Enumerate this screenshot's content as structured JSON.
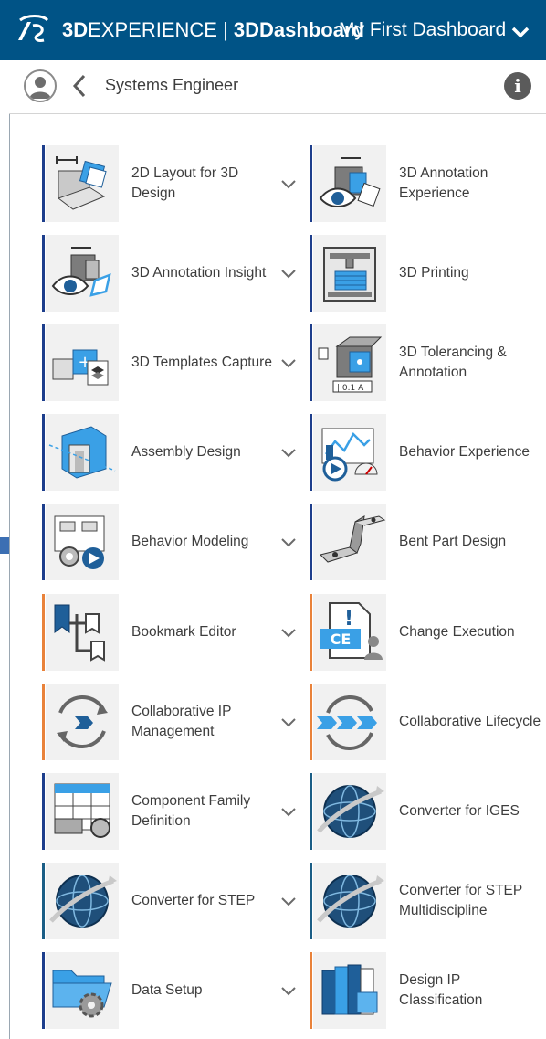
{
  "header": {
    "brand_bold": "3D",
    "brand_thin": "EXPERIENCE",
    "separator": " | ",
    "app": "3DDashboard",
    "dashboard_title": "My First Dashboard"
  },
  "subheader": {
    "role": "Systems Engineer"
  },
  "colors": {
    "topbar": "#005386",
    "navy_accent": "#1d3e8c",
    "orange_accent": "#e9823a",
    "teal_accent": "#1b5e86"
  },
  "apps": [
    {
      "label": "2D Layout for 3D\nDesign",
      "icon": "layout-2d-icon",
      "accent": "navy"
    },
    {
      "label": "3D Annotation\nExperience",
      "icon": "annotation-experience-icon",
      "accent": "navy"
    },
    {
      "label": "3D Annotation Insight",
      "icon": "annotation-insight-icon",
      "accent": "navy"
    },
    {
      "label": "3D Printing",
      "icon": "printer-3d-icon",
      "accent": "navy"
    },
    {
      "label": "3D Templates Capture",
      "icon": "templates-capture-icon",
      "accent": "navy"
    },
    {
      "label": "3D Tolerancing &\nAnnotation",
      "icon": "tolerancing-icon",
      "accent": "navy"
    },
    {
      "label": "Assembly Design",
      "icon": "assembly-icon",
      "accent": "navy"
    },
    {
      "label": "Behavior Experience",
      "icon": "behavior-experience-icon",
      "accent": "navy"
    },
    {
      "label": "Behavior Modeling",
      "icon": "behavior-modeling-icon",
      "accent": "navy"
    },
    {
      "label": "Bent Part Design",
      "icon": "bent-part-icon",
      "accent": "navy"
    },
    {
      "label": "Bookmark Editor",
      "icon": "bookmark-icon",
      "accent": "orange"
    },
    {
      "label": "Change Execution",
      "icon": "change-execution-icon",
      "accent": "orange"
    },
    {
      "label": "Collaborative IP\nManagement",
      "icon": "collab-ip-icon",
      "accent": "orange"
    },
    {
      "label": "Collaborative Lifecycle",
      "icon": "collab-lifecycle-icon",
      "accent": "orange"
    },
    {
      "label": "Component Family\nDefinition",
      "icon": "component-family-icon",
      "accent": "navy"
    },
    {
      "label": "Converter for IGES",
      "icon": "globe-icon",
      "accent": "teal"
    },
    {
      "label": "Converter for STEP",
      "icon": "globe-icon",
      "accent": "teal"
    },
    {
      "label": "Converter for STEP\nMultidiscipline",
      "icon": "globe-icon",
      "accent": "teal"
    },
    {
      "label": "Data Setup",
      "icon": "folder-gear-icon",
      "accent": "navy"
    },
    {
      "label": "Design IP\nClassification",
      "icon": "classification-icon",
      "accent": "orange"
    }
  ]
}
